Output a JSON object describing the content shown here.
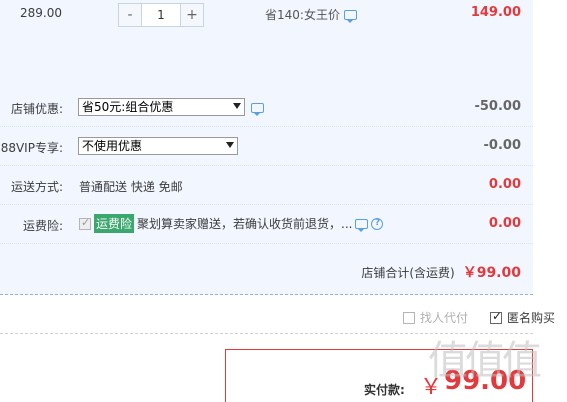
{
  "item": {
    "unit_price": "289.00",
    "qty_minus": "-",
    "qty_value": "1",
    "qty_plus": "+",
    "saving": "省140:女王价",
    "row_total": "149.00"
  },
  "shop_discount": {
    "label": "店铺优惠:",
    "selected": "省50元:组合优惠",
    "amount": "-50.00"
  },
  "vip": {
    "label": "88VIP专享:",
    "selected": "不使用优惠",
    "amount": "-0.00"
  },
  "shipping": {
    "label": "运送方式:",
    "text": "普通配送 快递 免邮",
    "amount": "0.00"
  },
  "insurance": {
    "label": "运费险:",
    "badge": "运费险",
    "text": "聚划算卖家赠送，若确认收货前退货，...",
    "help": "?",
    "amount": "0.00"
  },
  "subtotal": {
    "label": "店铺合计(含运费)",
    "value": "￥99.00"
  },
  "options": {
    "proxy_pay": "找人代付",
    "anonymous": "匿名购买"
  },
  "payment": {
    "label": "实付款:",
    "currency": "￥",
    "value": "99.00"
  },
  "watermark": "值值值",
  "colors": {
    "accent_red": "#e4393c",
    "panel_bg": "#f2f7ff",
    "badge_green": "#3aa76d",
    "icon_blue": "#5aa0e0"
  }
}
